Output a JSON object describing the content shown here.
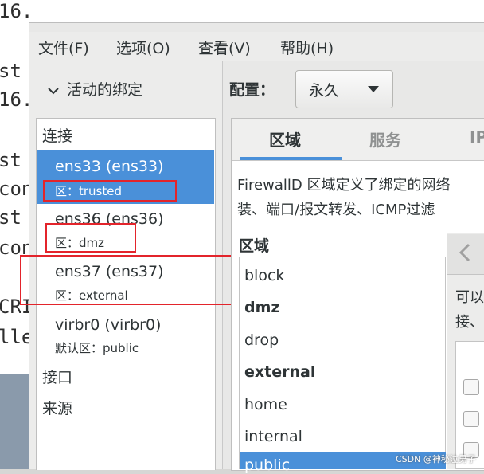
{
  "terminal": {
    "lines": [
      "16.",
      "st",
      "16.",
      "st",
      "con",
      "st",
      "con",
      "CRI",
      "lle"
    ]
  },
  "menubar": {
    "file": "文件(F)",
    "options": "选项(O)",
    "view": "查看(V)",
    "help": "帮助(H)"
  },
  "sidebar": {
    "active_bindings_label": "活动的绑定",
    "connections_label": "连接",
    "connections": [
      {
        "name": "ens33 (ens33)",
        "zone": "区：trusted"
      },
      {
        "name": "ens36 (ens36)",
        "zone": "区：dmz"
      },
      {
        "name": "ens37 (ens37)",
        "zone": "区：external"
      },
      {
        "name": "virbr0 (virbr0)",
        "zone": "默认区：public"
      }
    ],
    "interfaces_label": "接口",
    "sources_label": "来源"
  },
  "config": {
    "label": "配置：",
    "value": "永久"
  },
  "tabs": {
    "zones": "区域",
    "services": "服务",
    "ip": "IP"
  },
  "description": {
    "line1": "FirewallD 区域定义了绑定的网络",
    "line2": "装、端口/报文转发、ICMP过滤"
  },
  "zones": {
    "header": "区域",
    "items": [
      "block",
      "dmz",
      "drop",
      "external",
      "home",
      "internal",
      "public"
    ]
  },
  "right_panel": {
    "line1": "可以",
    "line2": "接、"
  },
  "watermark": "CSDN @神秘泣男子",
  "colors": {
    "selection": "#4a90d9",
    "highlight_box": "#e3242b"
  }
}
